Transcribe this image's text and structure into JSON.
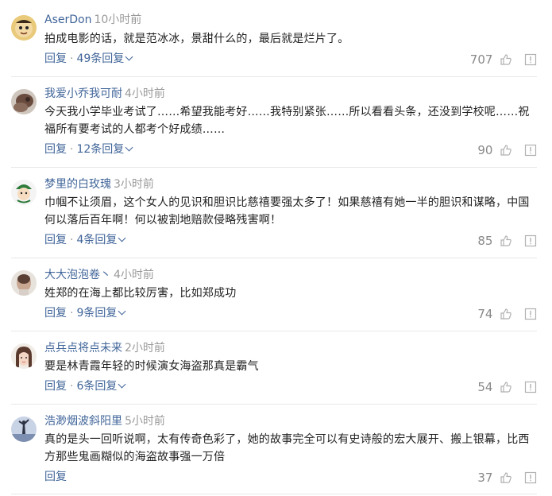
{
  "comments": [
    {
      "username": "AserDon",
      "time": "10小时前",
      "text": "拍成电影的话，就是范冰冰，景甜什么的，最后就是烂片了。",
      "reply_label": "回复",
      "replies_label": "49条回复",
      "likes": "707",
      "avatar_icon": "cartoon-face-icon"
    },
    {
      "username": "我爱小乔我可耐",
      "time": "4小时前",
      "text": "今天我小学毕业考试了……希望我能考好……我特别紧张……所以看看头条，还没到学校呢……祝福所有要考试的人都考个好成绩……",
      "reply_label": "回复",
      "replies_label": "12条回复",
      "likes": "90",
      "avatar_icon": "photo-avatar-icon"
    },
    {
      "username": "梦里的白玫瑰",
      "time": "3小时前",
      "text": "巾帼不让须眉，这个女人的见识和胆识比慈禧要强太多了！如果慈禧有她一半的胆识和谋略，中国何以落后百年啊！何以被割地赔款侵略残害啊！",
      "reply_label": "回复",
      "replies_label": "4条回复",
      "likes": "85",
      "avatar_icon": "cartoon-character-icon"
    },
    {
      "username": "大大泡泡卷丶",
      "time": "4小时前",
      "text": "姓郑的在海上都比较厉害，比如郑成功",
      "reply_label": "回复",
      "replies_label": "9条回复",
      "likes": "74",
      "avatar_icon": "photo-avatar-icon"
    },
    {
      "username": "点兵点将点未来",
      "time": "2小时前",
      "text": "要是林青霞年轻的时候演女海盗那真是霸气",
      "reply_label": "回复",
      "replies_label": "6条回复",
      "likes": "54",
      "avatar_icon": "girl-photo-icon"
    },
    {
      "username": "浩渺烟波斜阳里",
      "time": "5小时前",
      "text": "真的是头一回听说啊，太有传奇色彩了，她的故事完全可以有史诗般的宏大展开、搬上银幕，比西方那些鬼画糊似的海盗故事强一万倍",
      "reply_label": "回复",
      "replies_label": "",
      "likes": "37",
      "avatar_icon": "statue-photo-icon"
    }
  ],
  "colors": {
    "username": "#406599",
    "link": "#406599",
    "time": "#999999",
    "text": "#222222",
    "divider": "#e8e8e8"
  }
}
